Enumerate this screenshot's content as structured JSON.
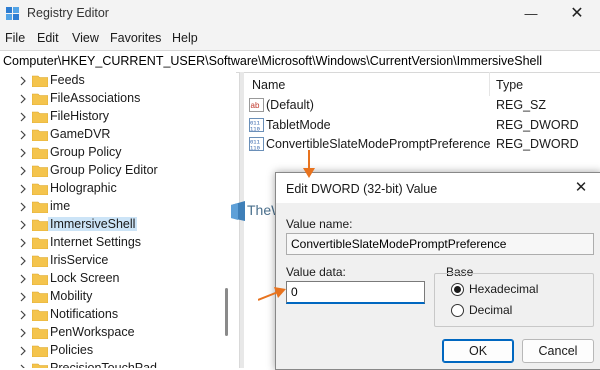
{
  "window": {
    "title": "Registry Editor"
  },
  "menu": [
    "File",
    "Edit",
    "View",
    "Favorites",
    "Help"
  ],
  "address": {
    "path": "Computer\\HKEY_CURRENT_USER\\Software\\Microsoft\\Windows\\CurrentVersion\\ImmersiveShell"
  },
  "tree": {
    "items": [
      {
        "label": "Feeds"
      },
      {
        "label": "FileAssociations"
      },
      {
        "label": "FileHistory"
      },
      {
        "label": "GameDVR"
      },
      {
        "label": "Group Policy"
      },
      {
        "label": "Group Policy Editor"
      },
      {
        "label": "Holographic"
      },
      {
        "label": "ime"
      },
      {
        "label": "ImmersiveShell",
        "selected": true
      },
      {
        "label": "Internet Settings"
      },
      {
        "label": "IrisService"
      },
      {
        "label": "Lock Screen"
      },
      {
        "label": "Mobility"
      },
      {
        "label": "Notifications"
      },
      {
        "label": "PenWorkspace"
      },
      {
        "label": "Policies"
      },
      {
        "label": "PrecisionTouchPad"
      }
    ]
  },
  "list": {
    "columns": {
      "name": "Name",
      "type": "Type"
    },
    "rows": [
      {
        "name": "(Default)",
        "type": "REG_SZ",
        "icon": "string-value-icon"
      },
      {
        "name": "TabletMode",
        "type": "REG_DWORD",
        "icon": "dword-value-icon"
      },
      {
        "name": "ConvertibleSlateModePromptPreference",
        "type": "REG_DWORD",
        "icon": "dword-value-icon"
      }
    ]
  },
  "dialog": {
    "title": "Edit DWORD (32-bit) Value",
    "value_name_label": "Value name:",
    "value_name": "ConvertibleSlateModePromptPreference",
    "value_data_label": "Value data:",
    "value_data": "0",
    "base_label": "Base",
    "base_options": [
      {
        "label": "Hexadecimal",
        "checked": true
      },
      {
        "label": "Decimal",
        "checked": false
      }
    ],
    "ok_label": "OK",
    "cancel_label": "Cancel"
  },
  "watermark": {
    "text": "TheWindowsClub"
  },
  "colors": {
    "accent": "#0067c0",
    "arrow": "#e8731e",
    "folder": "#f4c44d",
    "selection": "#cce4f7"
  }
}
